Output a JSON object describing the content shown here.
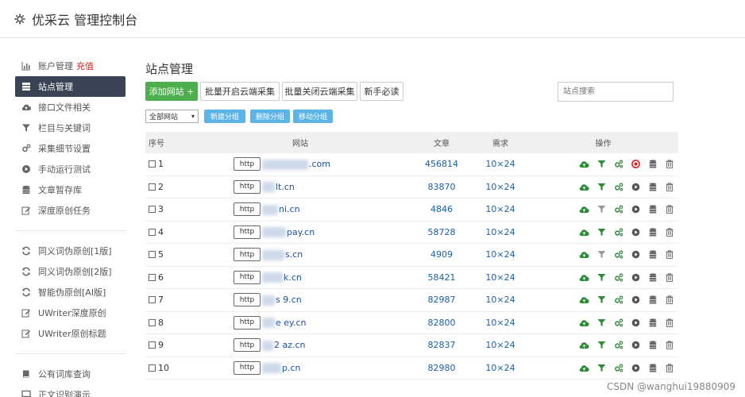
{
  "header": {
    "title": "优采云 管理控制台",
    "icon": "gear-icon"
  },
  "sidebar": {
    "groups": [
      [
        {
          "label": "账户管理",
          "extra": "充值",
          "icon": "bar-chart-icon"
        },
        {
          "label": "站点管理",
          "icon": "server-icon",
          "active": true
        },
        {
          "label": "接口文件相关",
          "icon": "cloud-upload-icon"
        },
        {
          "label": "栏目与关键词",
          "icon": "filter-icon"
        },
        {
          "label": "采集细节设置",
          "icon": "cogs-icon"
        },
        {
          "label": "手动运行测试",
          "icon": "play-circle-icon"
        },
        {
          "label": "文章暂存库",
          "icon": "database-icon"
        },
        {
          "label": "深度原创任务",
          "icon": "edit-icon"
        }
      ],
      [
        {
          "label": "同义词伪原创[1版]",
          "icon": "refresh-icon"
        },
        {
          "label": "同义词伪原创[2版]",
          "icon": "refresh-icon"
        },
        {
          "label": "智能伪原创[AI版]",
          "icon": "refresh-icon"
        },
        {
          "label": "UWriter深度原创",
          "icon": "edit-icon"
        },
        {
          "label": "UWriter原创标题",
          "icon": "edit-icon"
        }
      ],
      [
        {
          "label": "公有词库查询",
          "icon": "book-icon"
        },
        {
          "label": "正文识别演示",
          "icon": "monitor-icon"
        }
      ]
    ]
  },
  "main": {
    "title": "站点管理",
    "buttons": {
      "add": "添加网站 +",
      "batch_open": "批量开启云端采集",
      "batch_close": "批量关闭云端采集",
      "guide": "新手必读"
    },
    "search_placeholder": "站点搜索",
    "filter": {
      "selected": "全部网站"
    },
    "group_buttons": {
      "new": "新建分组",
      "delete": "删除分组",
      "move": "移动分组"
    },
    "table": {
      "headers": {
        "no": "序号",
        "site": "网站",
        "articles": "文章",
        "demand": "需求",
        "ops": "操作"
      },
      "rows": [
        {
          "no": "1",
          "prefix": "http",
          "domain": ".com",
          "blur": 58,
          "articles": "456814",
          "demand": "10×24",
          "play_red": true
        },
        {
          "no": "2",
          "prefix": "http",
          "domain": "lt.cn",
          "blur": 16,
          "articles": "83870",
          "demand": "10×24",
          "play_red": false
        },
        {
          "no": "3",
          "prefix": "http",
          "domain": "ni.cn",
          "blur": 20,
          "articles": "4846",
          "demand": "10×24",
          "play_red": false
        },
        {
          "no": "4",
          "prefix": "http",
          "domain": "pay.cn",
          "blur": 30,
          "articles": "58728",
          "demand": "10×24",
          "play_red": false
        },
        {
          "no": "5",
          "prefix": "http",
          "domain": "s.cn",
          "blur": 28,
          "articles": "4909",
          "demand": "10×24",
          "play_red": false
        },
        {
          "no": "6",
          "prefix": "http",
          "domain": "k.cn",
          "blur": 26,
          "articles": "58421",
          "demand": "10×24",
          "play_red": false
        },
        {
          "no": "7",
          "prefix": "http",
          "domain": "s   9.cn",
          "blur": 16,
          "articles": "82987",
          "demand": "10×24",
          "play_red": false
        },
        {
          "no": "8",
          "prefix": "http",
          "domain": "e   ey.cn",
          "blur": 16,
          "articles": "82800",
          "demand": "10×24",
          "play_red": false
        },
        {
          "no": "9",
          "prefix": "http",
          "domain": "2   az.cn",
          "blur": 14,
          "articles": "82837",
          "demand": "10×24",
          "play_red": false
        },
        {
          "no": "10",
          "prefix": "http",
          "domain": "p.cn",
          "blur": 24,
          "articles": "82980",
          "demand": "10×24",
          "play_red": false
        }
      ]
    }
  },
  "watermark": "CSDN @wanghui19880909",
  "colors": {
    "green": "#4cae4c",
    "blue": "#5bb3e6",
    "active_nav": "#3a4454",
    "link": "#1a5fa8",
    "red": "#e02020"
  }
}
